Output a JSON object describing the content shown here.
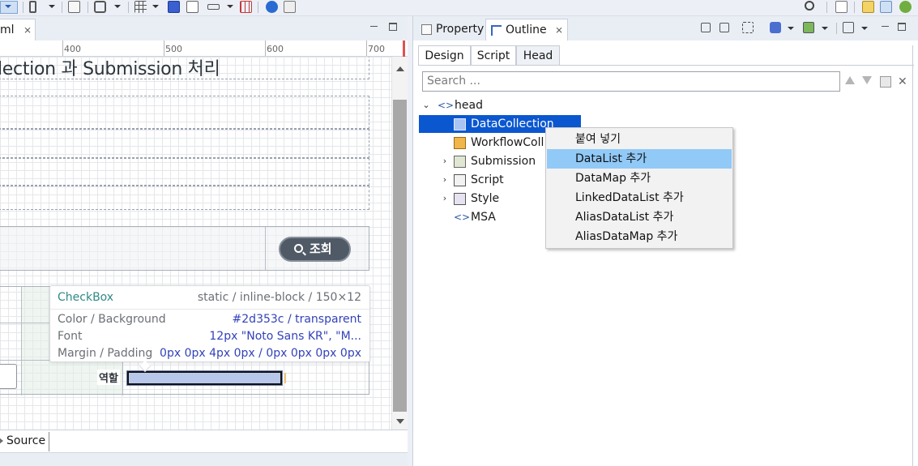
{
  "editor": {
    "tab_label": "ml",
    "tab_close": "⨯",
    "ruler_labels": [
      "400",
      "500",
      "600",
      "700"
    ],
    "heading": "lection 과 Submission 처리",
    "search_button_label": "조회",
    "role_label": "역할",
    "bottom_tab": "Source"
  },
  "tooltip": {
    "element": "CheckBox",
    "meta": "static / inline-block / 150×12",
    "rows": [
      {
        "label": "Color / Background",
        "value": "#2d353c / transparent"
      },
      {
        "label": "Font",
        "value": "12px \"Noto Sans KR\", \"M..."
      },
      {
        "label": "Margin / Padding",
        "value": "0px 0px 4px 0px / 0px 0px 0px 0px"
      }
    ]
  },
  "right_pane": {
    "tabs": [
      {
        "label": "Property"
      },
      {
        "label": "Outline",
        "close": "⨯"
      }
    ],
    "subtabs": [
      "Design",
      "Script",
      "Head"
    ],
    "active_subtab": "Head",
    "search_placeholder": "Search ..."
  },
  "outline_tree": {
    "root": {
      "label": "head",
      "expanded": true
    },
    "items": [
      {
        "label": "DataCollection",
        "selected": true,
        "expandable": false,
        "icon": "datacollection-icon"
      },
      {
        "label": "WorkflowColl",
        "expandable": false,
        "icon": "workflow-icon"
      },
      {
        "label": "Submission",
        "expandable": true,
        "icon": "submission-icon"
      },
      {
        "label": "Script",
        "expandable": true,
        "icon": "script-icon"
      },
      {
        "label": "Style",
        "expandable": true,
        "icon": "style-icon"
      },
      {
        "label": "MSA",
        "expandable": false,
        "icon": "code-brackets-icon"
      }
    ]
  },
  "context_menu": {
    "items": [
      {
        "label": "붙여 넣기",
        "active": false
      },
      {
        "label": "DataList 추가",
        "active": true
      },
      {
        "label": "DataMap 추가",
        "active": false
      },
      {
        "label": "LinkedDataList 추가",
        "active": false
      },
      {
        "label": "AliasDataList 추가",
        "active": false
      },
      {
        "label": "AliasDataMap 추가",
        "active": false
      }
    ]
  },
  "colors": {
    "selection": "#0b57d0",
    "menu_highlight": "#91c9f7",
    "search_button": "#505a66",
    "tooltip_value": "#3242b9",
    "tooltip_element": "#2e8a87"
  }
}
